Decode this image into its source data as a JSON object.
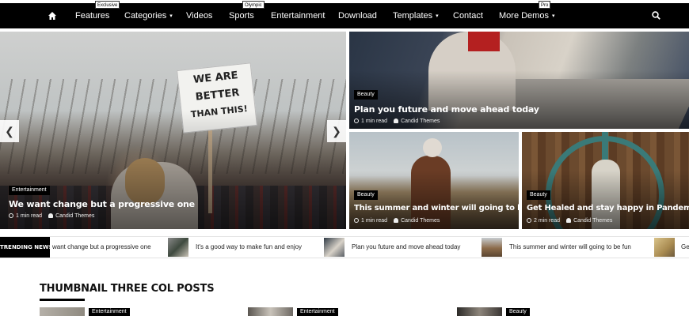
{
  "nav": {
    "items": [
      {
        "label": "Features",
        "badge": "Exclusive"
      },
      {
        "label": "Categories"
      },
      {
        "label": "Videos"
      },
      {
        "label": "Sports",
        "badge": "Olympic"
      },
      {
        "label": "Entertainment"
      },
      {
        "label": "Download"
      },
      {
        "label": "Templates"
      },
      {
        "label": "Contact"
      },
      {
        "label": "More Demos",
        "badge": "Pro"
      }
    ],
    "caret": "▾"
  },
  "slider": {
    "prev": "❮",
    "next": "❯",
    "sign_lines": [
      "WE ARE",
      "BETTER",
      "THAN THIS!"
    ]
  },
  "posts": [
    {
      "category": "Entertainment",
      "title": "We want change but a progressive one",
      "read": "1 min read",
      "author": "Candid Themes"
    },
    {
      "category": "Beauty",
      "title": "Plan you future and move ahead today",
      "read": "1 min read",
      "author": "Candid Themes"
    },
    {
      "category": "Beauty",
      "title": "This summer and winter will going to be fun",
      "read": "1 min read",
      "author": "Candid Themes"
    },
    {
      "category": "Beauty",
      "title": "Get Healed and stay happy in Pandemic",
      "read": "2 min read",
      "author": "Candid Themes"
    }
  ],
  "trending": {
    "label": "TRENDING NEWS",
    "items": [
      "want change but a progressive one",
      "It's a good way to make fun and enjoy",
      "Plan you future and move ahead today",
      "This summer and winter will going to be fun",
      "Ge"
    ]
  },
  "section": {
    "title": "THUMBNAIL THREE COL POSTS",
    "categories": [
      "Entertainment",
      "Entertainment",
      "Beauty"
    ]
  },
  "colors": {
    "nav_bg": "#000000",
    "badge_bg": "#000000",
    "text": "#111111"
  }
}
